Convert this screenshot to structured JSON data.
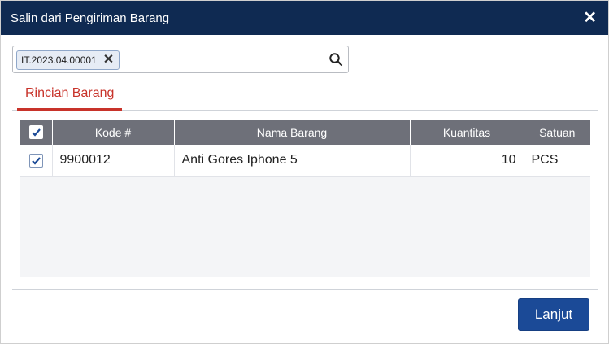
{
  "dialog": {
    "title": "Salin dari Pengiriman Barang",
    "close_icon": "close-icon",
    "search": {
      "tag": "IT.2023.04.00001",
      "remove_icon": "close-icon",
      "search_icon": "search-icon",
      "value": ""
    },
    "tabs": [
      {
        "label": "Rincian Barang",
        "active": true
      }
    ],
    "table": {
      "columns": [
        "Kode #",
        "Nama Barang",
        "Kuantitas",
        "Satuan"
      ],
      "header_checked": true,
      "rows": [
        {
          "checked": true,
          "kode": "9900012",
          "nama": "Anti Gores Iphone 5",
          "kuantitas": "10",
          "satuan": "PCS"
        }
      ]
    },
    "next_button": "Lanjut"
  },
  "colors": {
    "titlebar": "#0f2a52",
    "tab_active": "#c8332a",
    "table_header": "#6e7079",
    "primary_button": "#1b4a97"
  }
}
